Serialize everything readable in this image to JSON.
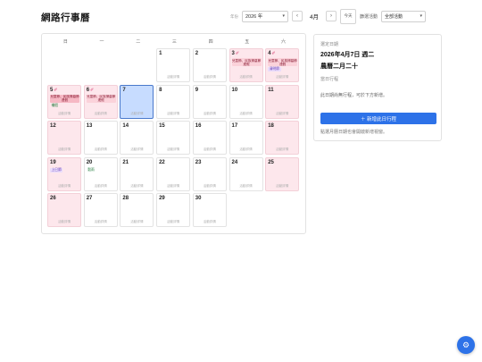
{
  "header": {
    "title": "網路行事曆"
  },
  "toolbar": {
    "year_label": "年份",
    "year_value": "2026 年",
    "prev": "‹",
    "month": "4月",
    "next": "›",
    "today": "今天",
    "filter_label": "篩選活動",
    "filter_value": "全部活動"
  },
  "calendar": {
    "weekdays": [
      "日",
      "一",
      "二",
      "三",
      "四",
      "五",
      "六"
    ],
    "cell_footer": "活動詳情",
    "days": [
      {
        "day": "",
        "weekend": false
      },
      {
        "day": "",
        "weekend": false
      },
      {
        "day": "",
        "weekend": false
      },
      {
        "day": "1",
        "weekend": false
      },
      {
        "day": "2",
        "weekend": false
      },
      {
        "day": "3",
        "weekend": true,
        "holiday": true,
        "event": "兒童節、民族掃墓節連假",
        "event_color": "lightred"
      },
      {
        "day": "4",
        "weekend": true,
        "holiday": true,
        "event": "兒童節、民族掃墓節連假",
        "event_color": "lightred",
        "tag": "清明節",
        "tag_color": "purple"
      },
      {
        "day": "5",
        "weekend": true,
        "holiday": true,
        "event": "兒童節、民族掃墓節連假",
        "event_color": "red",
        "tag": "補假",
        "tag_color": "green"
      },
      {
        "day": "6",
        "weekend": true,
        "holiday": true,
        "event": "兒童節、民族掃墓節連假",
        "event_color": "lightred"
      },
      {
        "day": "7",
        "weekend": false,
        "today": true
      },
      {
        "day": "8",
        "weekend": false
      },
      {
        "day": "9",
        "weekend": false
      },
      {
        "day": "10",
        "weekend": false
      },
      {
        "day": "11",
        "weekend": true
      },
      {
        "day": "12",
        "weekend": true
      },
      {
        "day": "13",
        "weekend": false
      },
      {
        "day": "14",
        "weekend": false
      },
      {
        "day": "15",
        "weekend": false
      },
      {
        "day": "16",
        "weekend": false
      },
      {
        "day": "17",
        "weekend": false
      },
      {
        "day": "18",
        "weekend": true
      },
      {
        "day": "19",
        "weekend": true,
        "tag": "上巳節",
        "tag_color": "purple"
      },
      {
        "day": "20",
        "weekend": false,
        "tag": "穀雨",
        "tag_color": "green"
      },
      {
        "day": "21",
        "weekend": false
      },
      {
        "day": "22",
        "weekend": false
      },
      {
        "day": "23",
        "weekend": false
      },
      {
        "day": "24",
        "weekend": false
      },
      {
        "day": "25",
        "weekend": true
      },
      {
        "day": "26",
        "weekend": true
      },
      {
        "day": "27",
        "weekend": false
      },
      {
        "day": "28",
        "weekend": false
      },
      {
        "day": "29",
        "weekend": false
      },
      {
        "day": "30",
        "weekend": false
      }
    ]
  },
  "side_panel": {
    "heading": "選定日期",
    "date": "2026年4月7日 週二",
    "lunar": "農曆二月二十",
    "sub": "當日行程",
    "empty": "此日期尚無行程，可於下方新增。",
    "add_button": "＋ 新增此日行程",
    "hint": "點選月曆日期也會開啟新增視窗。"
  },
  "fab": {
    "icon": "gear-icon",
    "glyph": "⚙"
  },
  "colors": {
    "accent": "#2d72e8",
    "weekend": "#fde7ec",
    "today": "#c7dcff"
  }
}
